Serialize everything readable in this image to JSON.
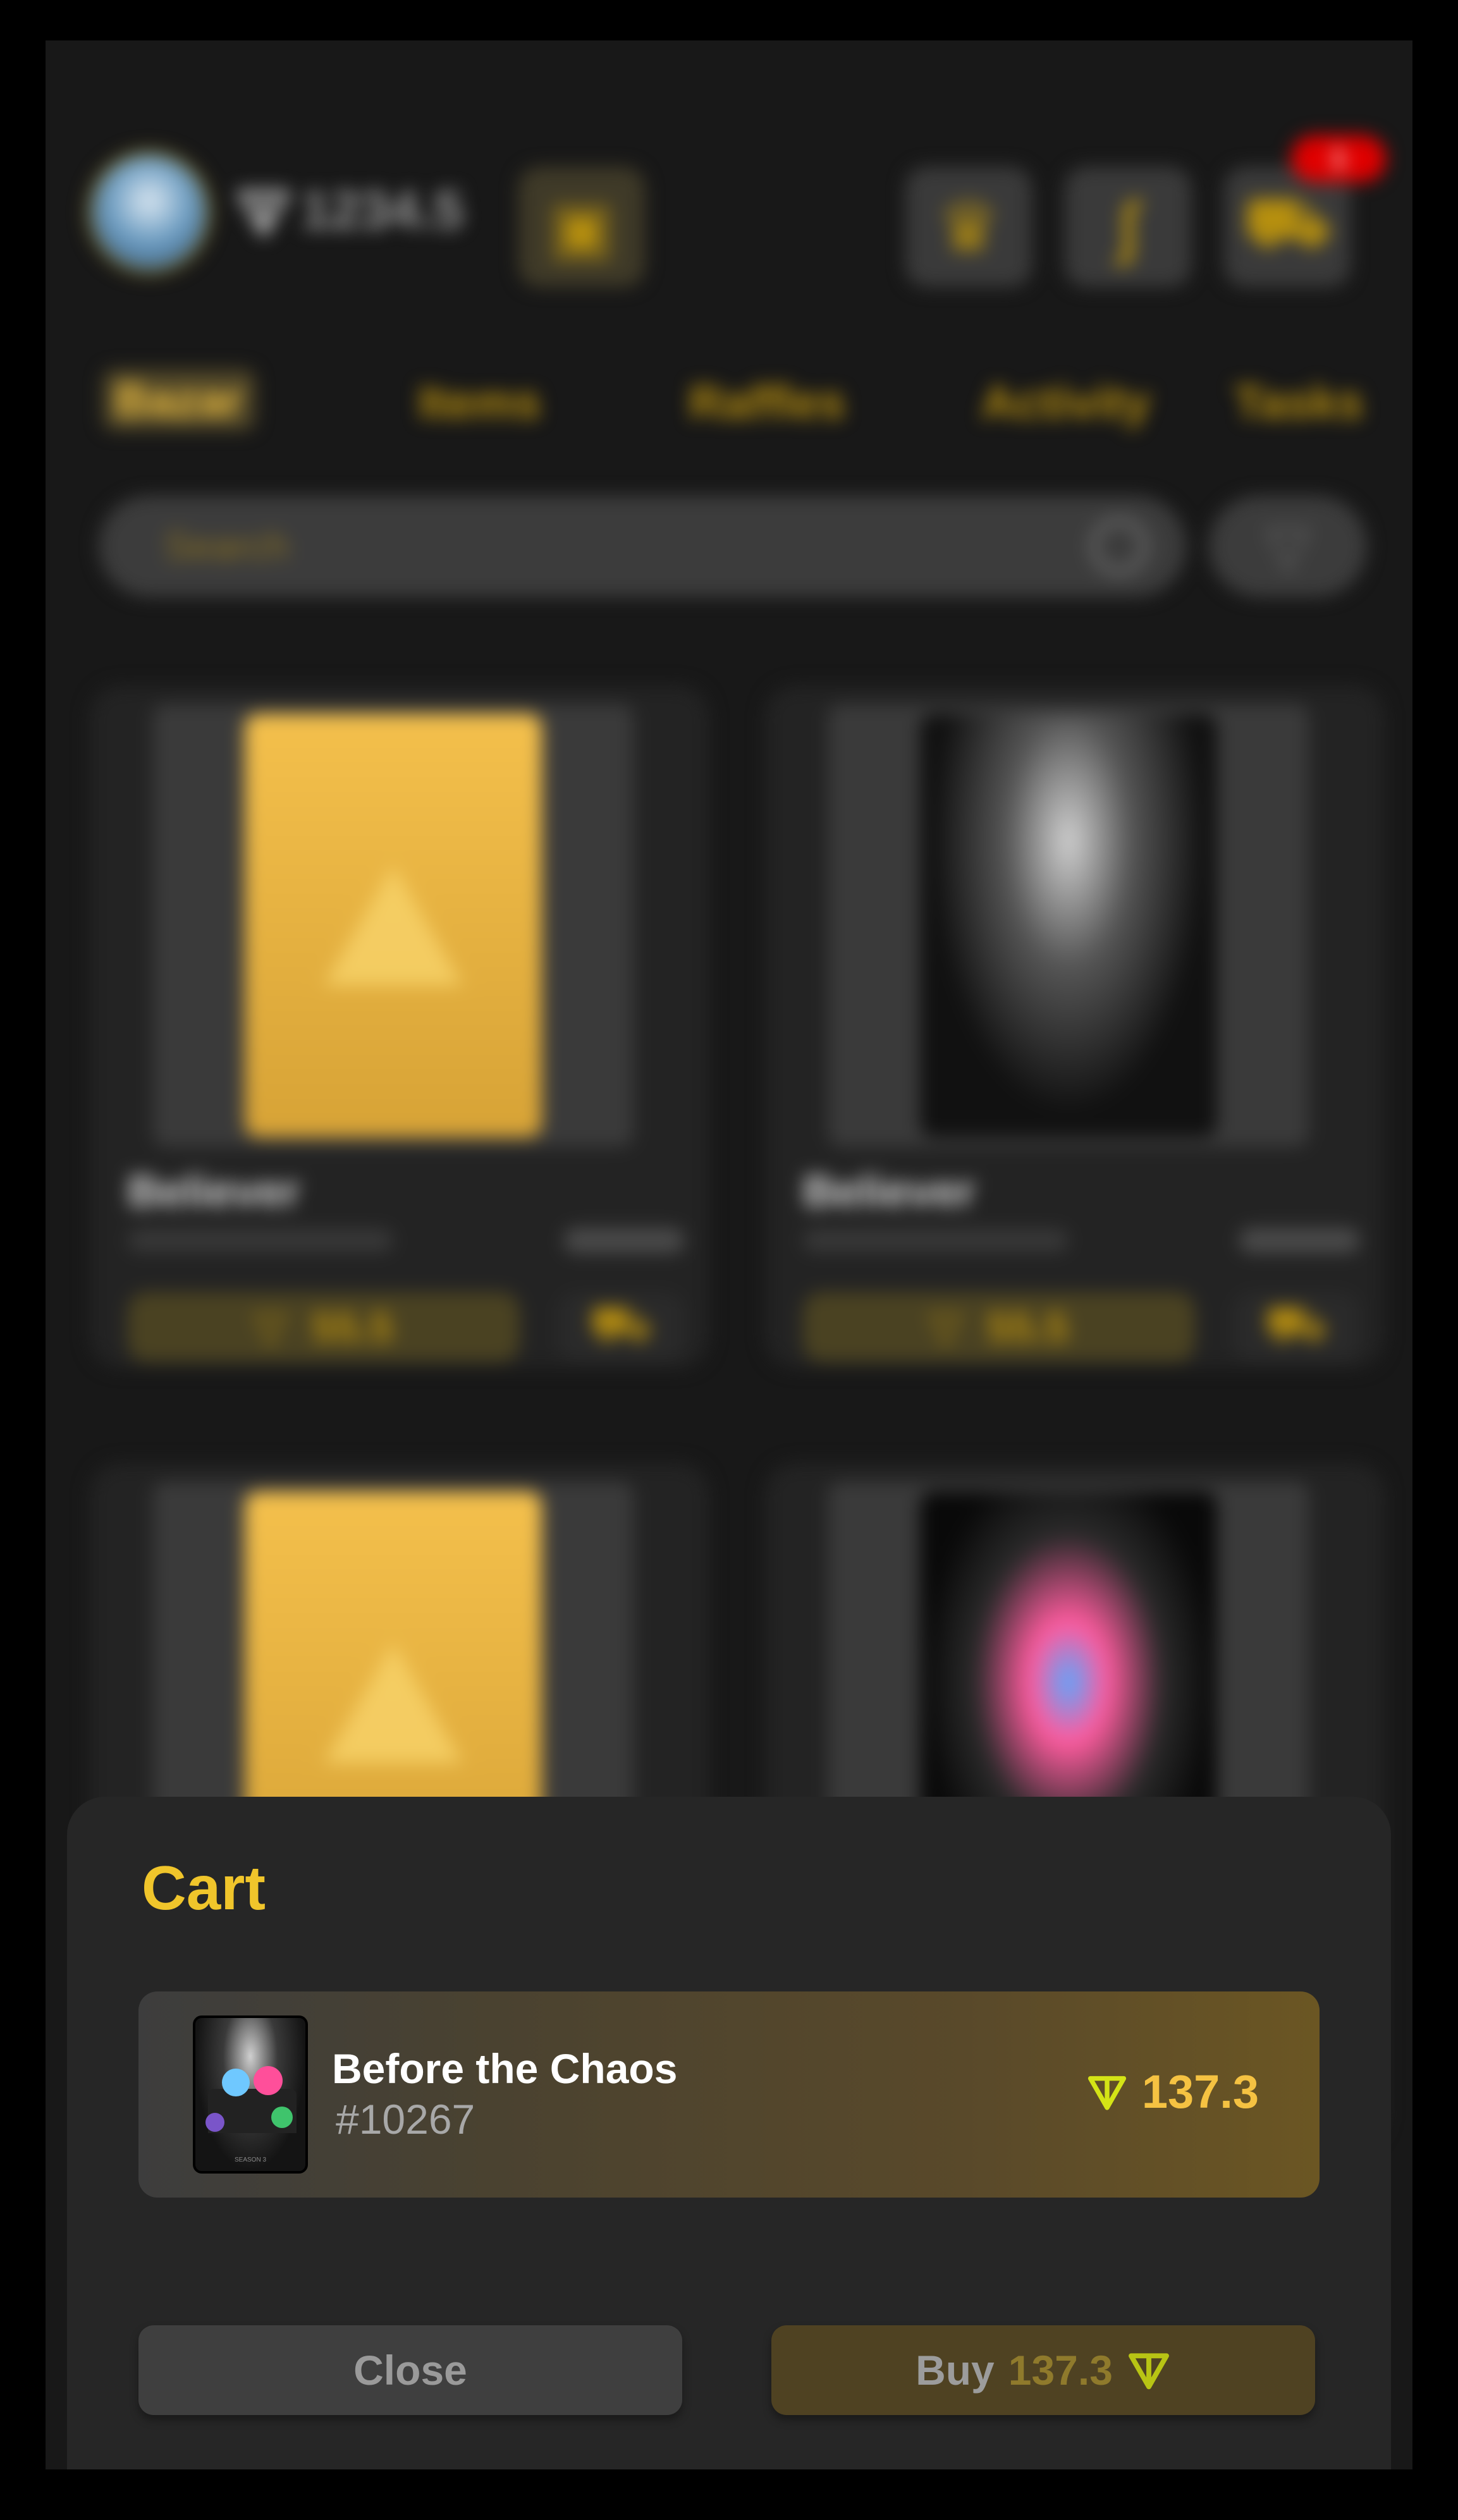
{
  "header": {
    "balance": "1234.5",
    "cart_badge": "1"
  },
  "tabs": [
    {
      "label": "Bazar",
      "active": true
    },
    {
      "label": "Items"
    },
    {
      "label": "Raffles"
    },
    {
      "label": "Activity"
    },
    {
      "label": "Tasks"
    }
  ],
  "search": {
    "placeholder": "Search"
  },
  "cards": [
    {
      "name": "Believer",
      "price": "55.5",
      "image": "placeholder-warning"
    },
    {
      "name": "Believer",
      "price": "55.5",
      "image": "hooded-figure"
    },
    {
      "name": "",
      "price": "",
      "image": "placeholder-warning"
    },
    {
      "name": "",
      "price": "",
      "image": "before-the-chaos"
    }
  ],
  "cart": {
    "title": "Cart",
    "items": [
      {
        "name": "Before the Chaos",
        "number": "#10267",
        "price": "137.3",
        "thumb_caption": "SEASON 3"
      }
    ],
    "close_label": "Close",
    "buy_label": "Buy",
    "buy_amount": "137.3"
  },
  "colors": {
    "accent": "#F0C52B",
    "ton_icon": "#D4E316",
    "sheet_bg": "#262626",
    "badge": "#E00000"
  },
  "icons": [
    "ton-icon",
    "wallet-icon",
    "trophy-icon",
    "pepe-icon",
    "cart-icon",
    "search-icon",
    "filter-icon",
    "warning-icon"
  ]
}
